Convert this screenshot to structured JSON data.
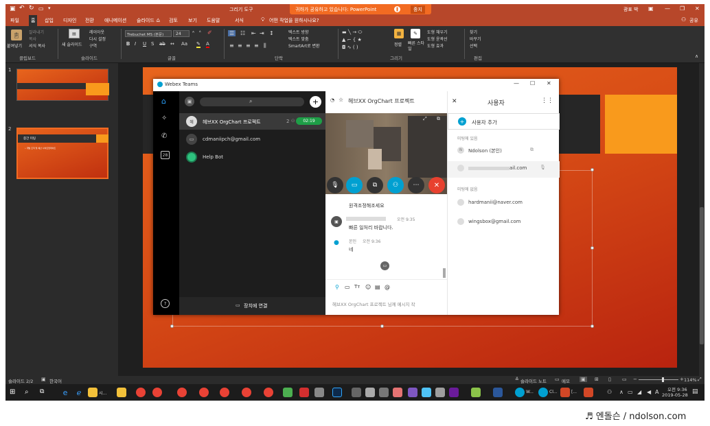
{
  "app": {
    "title": "그리기 도구",
    "share_banner": "귀하가 공유하고 있습니다: PowerPoint",
    "stop_label": "중지",
    "user_name": "광표 박",
    "share_label": "공유"
  },
  "tabs": [
    "파일",
    "홈",
    "삽입",
    "디자인",
    "전환",
    "애니메이션",
    "슬라이드 쇼",
    "검토",
    "보기",
    "도움말",
    "서식"
  ],
  "tell_me": "어떤 작업을 원하시나요?",
  "ribbon": {
    "groups": [
      "클립보드",
      "슬라이드",
      "글꼴",
      "단락",
      "그리기",
      "편집"
    ],
    "paste_label": "붙여넣기",
    "clipboard_items": [
      "잘라내기",
      "복사",
      "서식 복사"
    ],
    "new_slide_label": "새 슬라이드",
    "slide_items": [
      "레이아웃",
      "다시 설정",
      "구역"
    ],
    "font_name": "Trebuchet MS (본문)",
    "font_size": "24",
    "paragraph_items": [
      "텍스트 방향",
      "텍스트 맞춤",
      "SmartArt로 변환"
    ],
    "arrange_label": "정렬",
    "quick_styles_label": "빠른 스타일",
    "drawing_items": [
      "도형 채우기",
      "도형 윤곽선",
      "도형 효과"
    ],
    "editing_items": [
      "찾기",
      "바꾸기",
      "선택"
    ]
  },
  "thumbnails": [
    {
      "number": "1"
    },
    {
      "number": "2",
      "title": "중간 미팅",
      "bullet": "• 개발 조직 및 예산 사이트업데이트"
    }
  ],
  "statusbar": {
    "slide_count": "슬라이드 2/2",
    "language": "한국어",
    "notes_label": "슬라이드 노트",
    "comments_label": "메모",
    "zoom": "114%"
  },
  "taskbar": {
    "clock_time": "오전 9:36",
    "clock_date": "2019-05-28",
    "app_labels": [
      "시...",
      "W...",
      "Cl...",
      "[..."
    ]
  },
  "webex": {
    "window_title": "Webex Teams",
    "spaces": [
      {
        "name": "헤브XX OrgChart 프로젝트",
        "initial": "헤",
        "count": "2",
        "time": "02:19"
      },
      {
        "name": "cdmaniipch@gmail.com"
      },
      {
        "name": "Help Bot"
      }
    ],
    "connect_label": "장치에 연결",
    "rail_calendar_day": "28",
    "conversation_title": "헤브XX OrgChart 프로젝트",
    "messages": [
      {
        "text": "원격조정해조세요"
      },
      {
        "time": "오전 9:35",
        "text": "빠른 일처리 바랍니다."
      },
      {
        "sender": "본인",
        "time": "오전 9:36",
        "text": "네"
      }
    ],
    "compose_placeholder": "헤브XX OrgChart 프로젝트 님께 메시지 작",
    "users_title": "사용자",
    "add_user_label": "사용자 추가",
    "in_meeting_label": "미팅에 있음",
    "not_in_meeting_label": "미팅에 없음",
    "in_meeting": [
      {
        "name": "Ndolson (본인)"
      },
      {
        "name": "ail.com"
      }
    ],
    "not_in_meeting": [
      {
        "name": "hardmanii@naver.com"
      },
      {
        "name": "wingsbox@gmail.com"
      }
    ]
  },
  "watermark": "♬ 엔돌슨 / ndolson.com",
  "colors": {
    "ppt_red": "#b7472a",
    "webex_blue": "#00a0d1",
    "call_end_red": "#e8412f",
    "timer_green": "#1e9e47",
    "slide_orange": "#e8651d"
  }
}
